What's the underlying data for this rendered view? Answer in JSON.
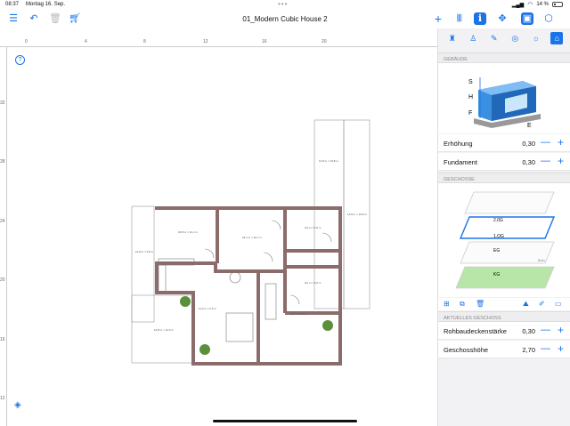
{
  "status_bar": {
    "time": "08:37",
    "date": "Montag 16. Sep.",
    "dots": "•••",
    "battery": "14 %"
  },
  "toolbar": {
    "title": "01_Modern Cubic House 2",
    "icons": [
      "sidebar-icon",
      "undo-icon",
      "trash-icon",
      "cart-icon",
      "add-icon",
      "library-icon",
      "info-icon",
      "move-icon",
      "2d-view-icon",
      "3d-view-icon"
    ]
  },
  "rulers": {
    "top": [
      "0",
      "4",
      "8",
      "12",
      "16",
      "20"
    ],
    "left": [
      "32",
      "28",
      "24",
      "20",
      "16",
      "12"
    ]
  },
  "plan_labels": {
    "room1": "20,8 m × 11,1 m",
    "room2": "24,1 m × 22,7 m",
    "room3": "9,9 m × 6,6 m",
    "room4": "14,8 m × 9,8 m",
    "room5": "9,0 m × 6,0 m",
    "room6": "11,6 m × 6,0 m",
    "room7": "10,8 m × 12,9 m",
    "room8": "12,8 m × 19,8 m",
    "room9": "9,1 m × 5,4 m",
    "room10": "14,8 m × 19,8 m"
  },
  "panel": {
    "section_building": "GEBÄUDE",
    "diagram_labels": {
      "s": "S",
      "h": "H",
      "f": "F",
      "e": "E"
    },
    "rows_building": [
      {
        "label": "Erhöhung",
        "value": "0,30"
      },
      {
        "label": "Fundament",
        "value": "0,30"
      }
    ],
    "section_floors": "GESCHOSSE",
    "floor_labels": [
      "2.0G",
      "1.OG",
      "EG",
      "KG"
    ],
    "floor_side_label": "Bodo",
    "section_current": "AKTUELLES GESCHOSS",
    "rows_current": [
      {
        "label": "Rohbaudeckenstärke",
        "value": "0,30"
      },
      {
        "label": "Geschosshöhe",
        "value": "2,70"
      }
    ]
  }
}
